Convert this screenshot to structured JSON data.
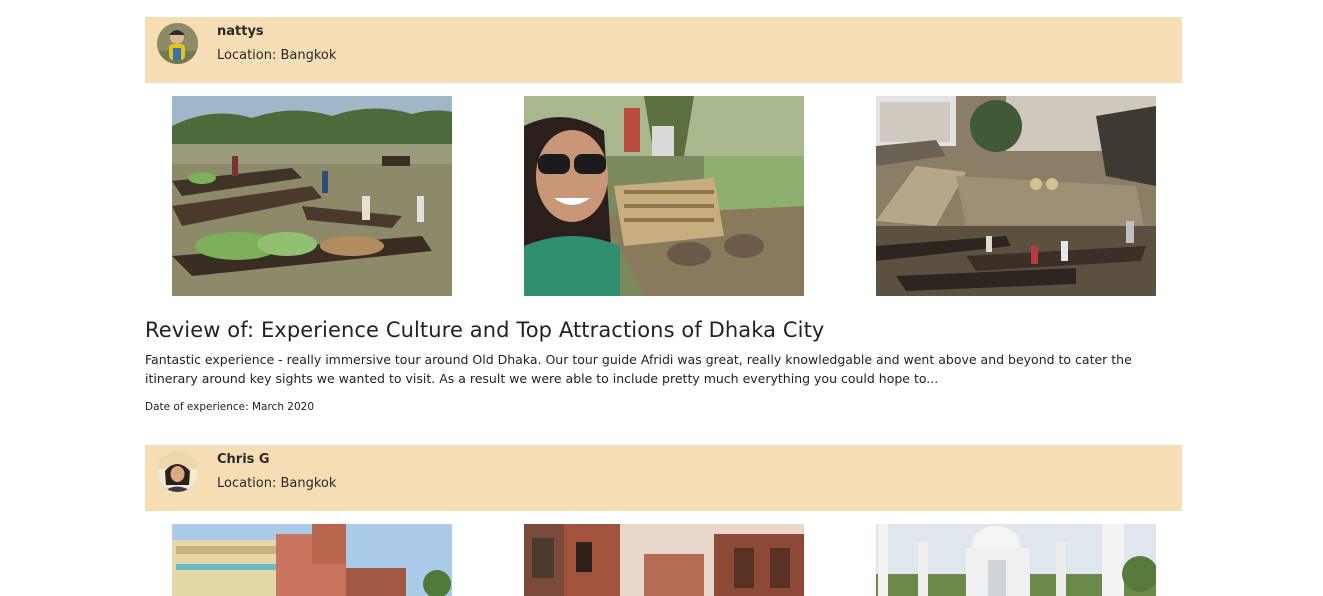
{
  "reviews": [
    {
      "user": {
        "name": "nattys",
        "location": "Location: Bangkok"
      },
      "photos": [
        "floating-market-boats-photo",
        "woman-selfie-boat-photo",
        "river-ghat-boats-photo"
      ],
      "title": "Review of: Experience Culture and Top Attractions of Dhaka City",
      "body": "Fantastic experience - really immersive tour around Old Dhaka. Our tour guide Afridi was great, really knowledgable and went above and beyond to cater the itinerary around key sights we wanted to visit. As a result we were able to include pretty much everything you could hope to...",
      "date": "Date of experience: March 2020"
    },
    {
      "user": {
        "name": "Chris G",
        "location": "Location: Bangkok"
      },
      "photos": [
        "colonial-building-photo",
        "old-brick-street-photo",
        "white-mosque-photo"
      ]
    }
  ],
  "colors": {
    "user_bar": "#f5ddb4"
  }
}
